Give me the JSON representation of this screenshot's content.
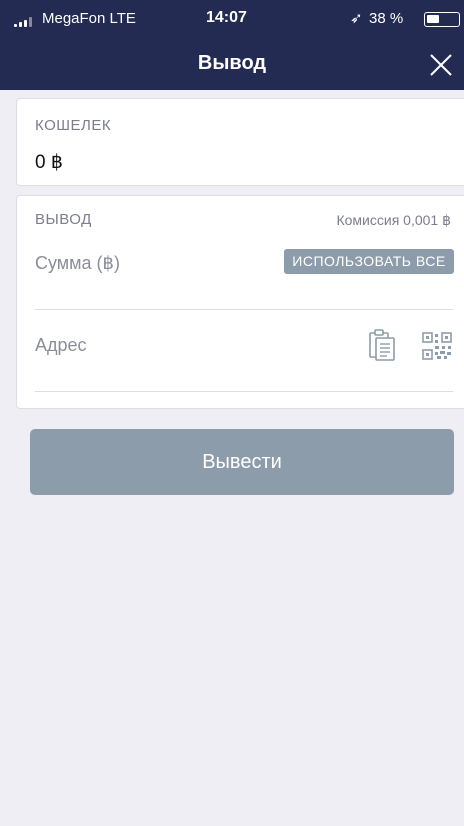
{
  "status_bar": {
    "carrier": "MegaFon  LTE",
    "time": "14:07",
    "battery": "38 %",
    "battery_level": 0.38
  },
  "nav": {
    "title": "Вывод",
    "close_icon": "close-icon"
  },
  "wallet": {
    "label": "КОШЕЛЕК",
    "balance": "0 ฿"
  },
  "withdraw": {
    "label": "ВЫВОД",
    "fee": "Комиссия 0,001 ฿",
    "amount_label": "Сумма (฿)",
    "use_all": "ИСПОЛЬЗОВАТЬ ВСЕ",
    "address_label": "Адрес",
    "paste_icon": "clipboard-icon",
    "scan_icon": "qr-code-icon"
  },
  "submit_label": "Вывести",
  "colors": {
    "header_bg": "#232b52",
    "page_bg": "#efeef4",
    "button_bg": "#8d9cab"
  }
}
